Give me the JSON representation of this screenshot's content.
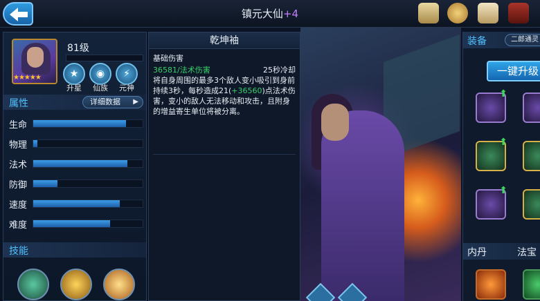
{
  "header": {
    "title": "镇元大仙",
    "title_suffix": "+4",
    "top_icons": [
      "scroll-icon",
      "coin-seal-icon",
      "letter-icon",
      "book-icon"
    ]
  },
  "hero": {
    "level": "81级",
    "stars": "★★★★★",
    "actions": [
      {
        "label": "升星",
        "icon": "star-up-icon"
      },
      {
        "label": "仙族",
        "icon": "clan-icon"
      },
      {
        "label": "元神",
        "icon": "spirit-icon"
      }
    ]
  },
  "attributes": {
    "title": "属性",
    "detail_button": "详细数据",
    "stats": [
      {
        "label": "生命",
        "value": 0.85
      },
      {
        "label": "物理",
        "value": 0.04
      },
      {
        "label": "法术",
        "value": 0.86
      },
      {
        "label": "防御",
        "value": 0.22
      },
      {
        "label": "速度",
        "value": 0.79
      },
      {
        "label": "难度",
        "value": 0.7
      }
    ]
  },
  "skills": {
    "title": "技能",
    "icons": [
      "skill-gourd-icon",
      "skill-gold-icon",
      "skill-burst-icon"
    ]
  },
  "tooltip": {
    "title": "乾坤袖",
    "type": "基础伤害",
    "damage": "36581/法术伤害",
    "cooldown": "25秒冷却",
    "desc_part1": "将自身周围的最多3个敌人变小吸引到身前持续3秒，每秒造成21(",
    "desc_highlight": "+36560",
    "desc_part2": ")点法术伤害，变小的敌人无法移动和攻击，且附身的增益寄生单位将被分离。"
  },
  "equipment": {
    "title": "装备",
    "tab": "二郎通灵",
    "upgrade_button": "一键升级"
  },
  "bottom_tabs": [
    "内丹",
    "法宝"
  ]
}
